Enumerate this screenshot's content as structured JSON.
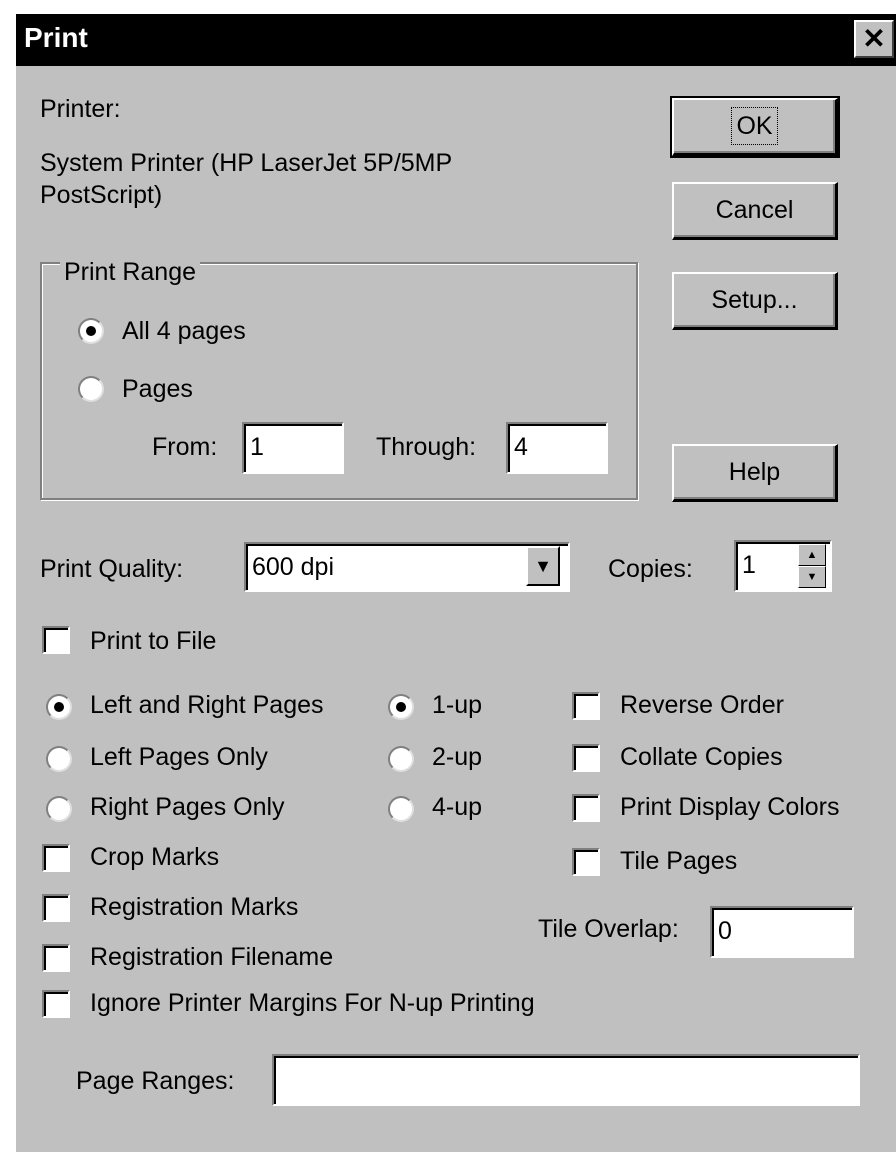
{
  "window": {
    "title": "Print",
    "close_glyph": "✕"
  },
  "printer": {
    "label": "Printer:",
    "name_line1": "System Printer (HP LaserJet 5P/5MP",
    "name_line2": "PostScript)"
  },
  "buttons": {
    "ok": "OK",
    "cancel": "Cancel",
    "setup": "Setup...",
    "help": "Help"
  },
  "print_range": {
    "legend": "Print Range",
    "all_pages": "All 4 pages",
    "pages": "Pages",
    "selected": "all",
    "from_label": "From:",
    "from_value": "1",
    "through_label": "Through:",
    "through_value": "4"
  },
  "quality": {
    "label": "Print Quality:",
    "value": "600 dpi",
    "arrow": "▼"
  },
  "copies": {
    "label": "Copies:",
    "value": "1",
    "up": "▲",
    "down": "▼"
  },
  "print_to_file": {
    "label": "Print to File",
    "checked": false
  },
  "page_side": {
    "options": [
      "Left and Right Pages",
      "Left Pages Only",
      "Right Pages Only"
    ],
    "selected": 0
  },
  "nup": {
    "options": [
      "1-up",
      "2-up",
      "4-up"
    ],
    "selected": 0
  },
  "right_checks": [
    "Reverse Order",
    "Collate Copies",
    "Print Display Colors",
    "Tile Pages"
  ],
  "left_checks": [
    "Crop Marks",
    "Registration Marks",
    "Registration Filename",
    "Ignore Printer Margins For N-up Printing"
  ],
  "tile_overlap": {
    "label": "Tile Overlap:",
    "value": "0"
  },
  "page_ranges": {
    "label": "Page Ranges:",
    "value": ""
  }
}
